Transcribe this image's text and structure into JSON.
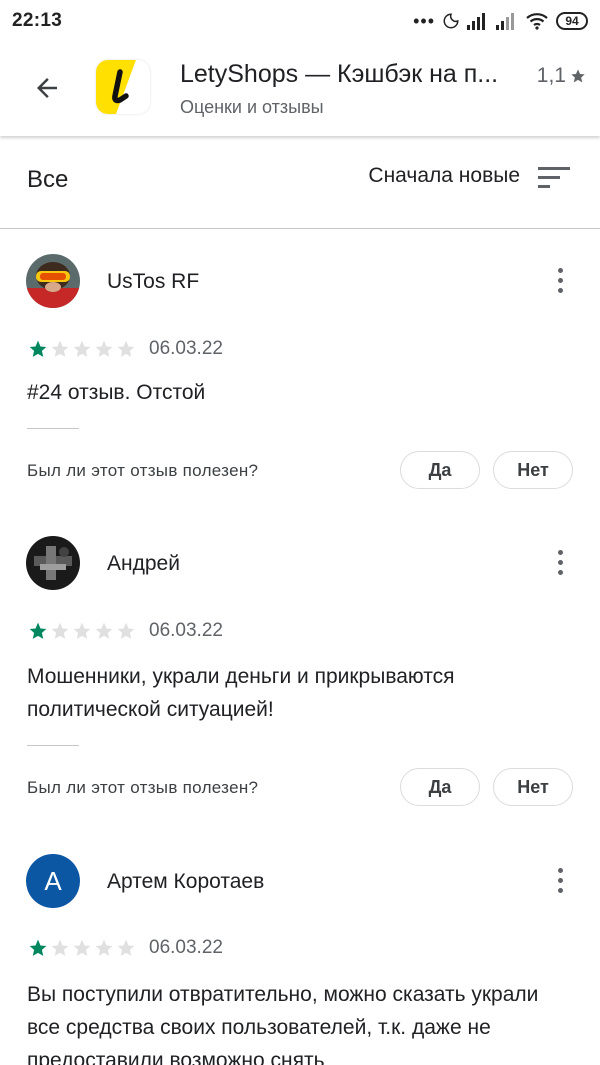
{
  "status_bar": {
    "time": "22:13",
    "battery": "94"
  },
  "app_header": {
    "title": "LetyShops — Кэшбэк на п...",
    "subtitle": "Оценки и отзывы",
    "rating": "1,1",
    "icon_bg": "#ffe000"
  },
  "filter": {
    "all_label": "Все",
    "sort_label": "Сначала новые"
  },
  "colors": {
    "star_filled": "#01875f",
    "star_empty": "#e0e0e0",
    "avatar_letter_bg": "#0b57a4"
  },
  "reviews": [
    {
      "name": "UsTos RF",
      "stars": 1,
      "date": "06.03.22",
      "text": "#24 отзыв. Отстой",
      "helpful_question": "Был ли этот отзыв полезен?",
      "yes": "Да",
      "no": "Нет"
    },
    {
      "name": "Андрей",
      "stars": 1,
      "date": "06.03.22",
      "text": "Мошенники, украли деньги и прикрываются политической ситуацией!",
      "helpful_question": "Был ли этот отзыв полезен?",
      "yes": "Да",
      "no": "Нет"
    },
    {
      "name": "Артем Коротаев",
      "avatar_letter": "А",
      "stars": 1,
      "date": "06.03.22",
      "text": "Вы поступили отвратительно, можно сказать украли все средства своих пользователей, т.к. даже не предоставили возможно снять"
    }
  ]
}
